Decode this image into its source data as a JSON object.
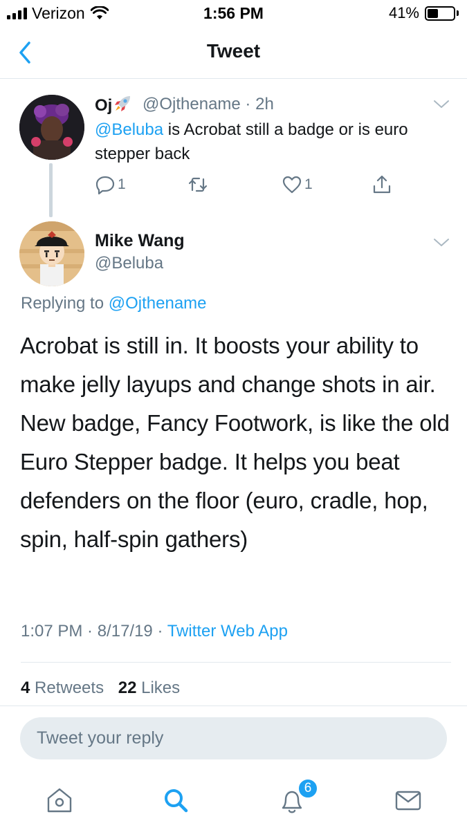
{
  "status_bar": {
    "carrier": "Verizon",
    "time": "1:56 PM",
    "battery_percent": "41%",
    "battery_level": 0.41
  },
  "nav": {
    "title": "Tweet",
    "back_icon": "chevron-left-icon"
  },
  "parent_tweet": {
    "name": "Oj",
    "name_emoji": "rocket-icon",
    "handle_time": "@Ojthename · 2h",
    "mention": "@Beluba",
    "text": " is Acrobat still a badge or is euro stepper back",
    "replies": "1",
    "likes": "1"
  },
  "main_tweet": {
    "name": "Mike Wang",
    "handle": "@Beluba",
    "replying_prefix": "Replying to ",
    "replying_to": "@Ojthename",
    "text": "Acrobat is still in. It boosts your ability to make jelly layups and change shots in air. New badge, Fancy Footwork, is like the old Euro Stepper badge. It helps you beat defenders on the floor (euro, cradle, hop, spin, half-spin gathers)",
    "timestamp": "1:07 PM · 8/17/19 · ",
    "source": "Twitter Web App",
    "retweets_count": "4",
    "retweets_label": " Retweets",
    "likes_count": "22",
    "likes_label": " Likes"
  },
  "reply": {
    "placeholder": "Tweet your reply"
  },
  "tabbar": {
    "notifications_badge": "6"
  },
  "colors": {
    "accent": "#1da1f2",
    "muted": "#657786",
    "text": "#14171a",
    "divider": "#e1e8ed"
  }
}
